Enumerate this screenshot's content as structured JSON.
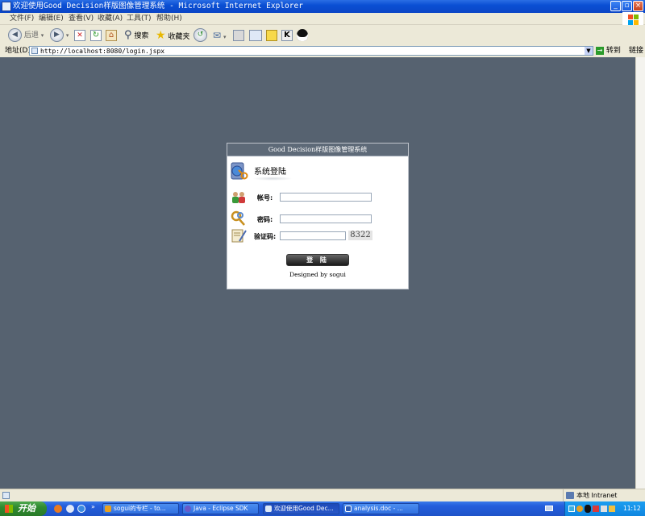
{
  "window": {
    "title": "欢迎使用Good Decision样版图像管理系统 - Microsoft Internet Explorer"
  },
  "menu": [
    "文件(F)",
    "编辑(E)",
    "查看(V)",
    "收藏(A)",
    "工具(T)",
    "帮助(H)"
  ],
  "toolbar": {
    "back_label": "后退",
    "search_label": "搜索",
    "favorites_label": "收藏夹"
  },
  "address": {
    "label": "地址(D)",
    "url": "http://localhost:8080/login.jspx",
    "go_label": "转到",
    "links_label": "链接"
  },
  "login": {
    "header": "Good Decision样版图像管理系统",
    "title": "系统登陆",
    "account_label": "帐号:",
    "password_label": "密码:",
    "captcha_label": "验证码:",
    "captcha_code": "8322",
    "login_button": "登 陆",
    "credit": "Designed by sogui"
  },
  "status": {
    "zone": "本地 Intranet"
  },
  "taskbar": {
    "start_label": "开始",
    "tasks": [
      "sogui的专栏 - to...",
      "Java - Eclipse SDK",
      "欢迎使用Good Dec...",
      "analysis.doc - ..."
    ],
    "clock": "11:12"
  },
  "colors": {
    "page_background": "#566270",
    "panel_header": "#5e6a78",
    "titlebar_blue": "#0A4FD4",
    "taskbar_blue": "#245edc",
    "start_green": "#2f8a2f"
  }
}
